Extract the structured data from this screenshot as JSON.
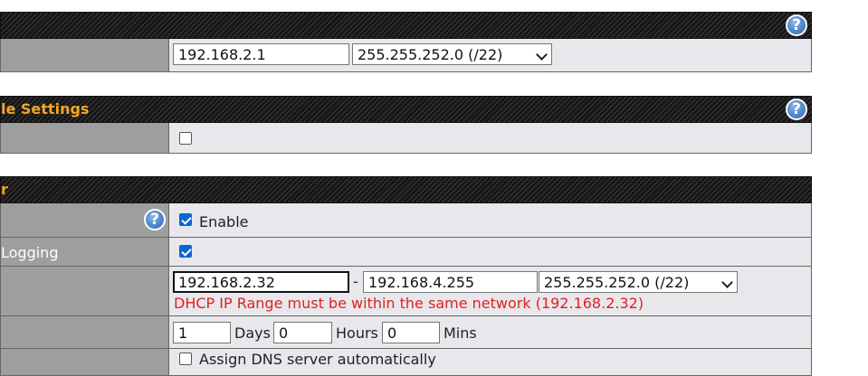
{
  "lan_section": {
    "ip_address": "192.168.2.1",
    "subnet_mask": "255.255.252.0 (/22)"
  },
  "settings_section": {
    "title": "le Settings"
  },
  "dhcp_section": {
    "title": "r",
    "enable_label": "Enable",
    "logging_label": "Logging",
    "range_start": "192.168.2.32",
    "range_separator": "-",
    "range_end": "192.168.4.255",
    "range_mask": "255.255.252.0 (/22)",
    "range_error": "DHCP IP Range must be within the same network (192.168.2.32)",
    "lease_days": "1",
    "lease_days_label": "Days",
    "lease_hours": "0",
    "lease_hours_label": "Hours",
    "lease_mins": "0",
    "lease_mins_label": "Mins",
    "dns_auto_label": "Assign DNS server automatically"
  },
  "help_glyph": "?",
  "colors": {
    "header_title": "#f5a623",
    "error_text": "#e02020",
    "checkbox_checked": "#0a66d8",
    "label_cell_bg": "#9e9e9e",
    "value_cell_bg": "#e8e8ec"
  },
  "icons": [
    "help-icon",
    "checkbox-checked",
    "checkbox-unchecked",
    "chevron-down-icon"
  ]
}
